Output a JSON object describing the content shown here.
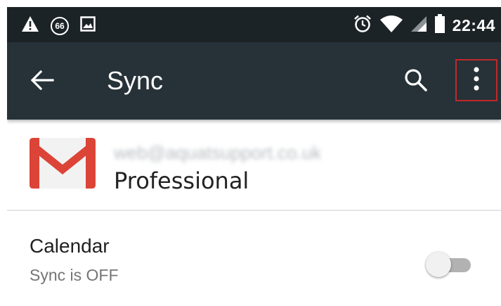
{
  "status_bar": {
    "notification_badge": "66",
    "time": "22:44",
    "icons": [
      "warning-icon",
      "sixty-six-badge-icon",
      "image-icon",
      "alarm-icon",
      "wifi-icon",
      "cell-signal-icon",
      "battery-icon"
    ]
  },
  "toolbar": {
    "title": "Sync",
    "icons": [
      "arrow-back-icon",
      "search-icon",
      "more-vert-icon"
    ],
    "highlight_color": "#c0282a"
  },
  "account": {
    "email": "web@aquatsupport.co.uk",
    "type": "Professional",
    "logo": "gmail-logo-icon"
  },
  "sync_items": [
    {
      "title": "Calendar",
      "status": "Sync is OFF",
      "enabled": false
    }
  ],
  "colors": {
    "status_bar": "#1c2327",
    "toolbar": "#263238",
    "gmail_red": "#db4437"
  }
}
